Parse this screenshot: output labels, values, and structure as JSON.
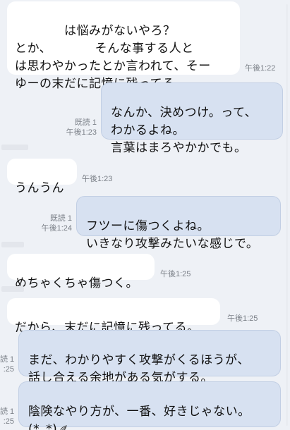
{
  "messages": [
    {
      "text": "　　　　は悩みがないやろ？\nとか、　　　　そんな事する人と\nは思わやかったとか言われて、そー\nゆーの末だに記憶に残ってる。",
      "time": "午後1:22"
    },
    {
      "text": "なんか、決めつけ。って、\nわかるよね。\n言葉はまろやかかでも。",
      "read": "既読 1",
      "time": "午後1:23"
    },
    {
      "text": "うんうん",
      "time": "午後1:23"
    },
    {
      "text": "フツーに傷つくよね。\nいきなり攻撃みたいな感じで。",
      "read": "既読 1",
      "time": "午後1:24"
    },
    {
      "text": "めちゃくちゃ傷つく。",
      "time": "午後1:25"
    },
    {
      "text": "だから、末だに記憶に残ってる。",
      "time": "午後1:25"
    },
    {
      "text": "まだ、わかりやすく攻撃がくるほうが、\n話し合える余地がある気がする。",
      "read": "読 1",
      "time": ":25"
    },
    {
      "text": "陰険なやり方が、一番、好きじゃない。\n(*_*)",
      "read": "読 1",
      "time": ":25",
      "emoji": "droplet-icon"
    }
  ],
  "colors": {
    "background": "#eef1f6",
    "incoming_bubble": "#ffffff",
    "outgoing_bubble": "#d7e1f1",
    "meta_text": "#7b8088"
  }
}
